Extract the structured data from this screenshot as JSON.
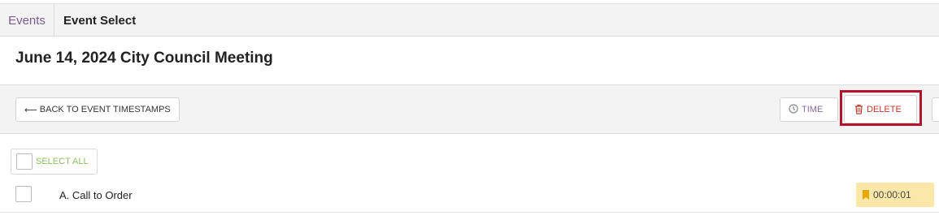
{
  "tabs": {
    "events_label": "Events",
    "current_label": "Event Select"
  },
  "page": {
    "title": "June 14, 2024 City Council Meeting"
  },
  "toolbar": {
    "back_label": "BACK TO EVENT TIMESTAMPS",
    "back_arrow": "⟵",
    "time_label": "TIME",
    "delete_label": "DELETE"
  },
  "selection": {
    "select_all_label": "SELECT ALL"
  },
  "items": [
    {
      "title": "A. Call to Order",
      "timestamp": "00:00:01"
    }
  ],
  "colors": {
    "accent_purple": "#7a5c8e",
    "delete_red": "#c0392b",
    "highlight": "#b5132d",
    "select_green": "#8dbf5a",
    "badge_yellow": "#fbe7a8"
  },
  "icons": {
    "time": "clock-icon",
    "delete": "trash-icon",
    "timestamp": "bookmark-icon"
  }
}
